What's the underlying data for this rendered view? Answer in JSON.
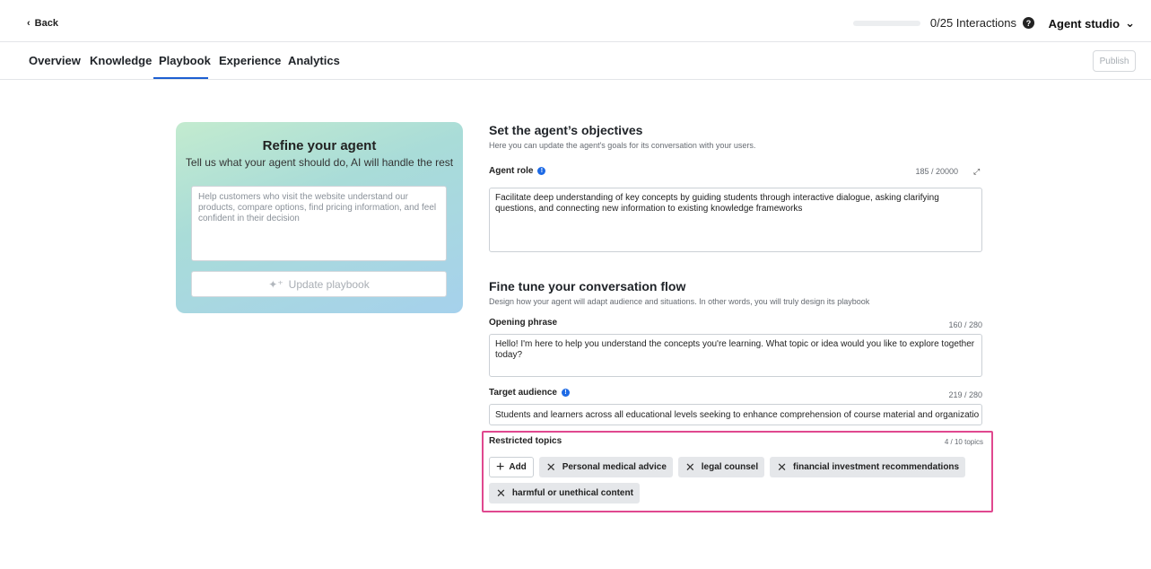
{
  "topbar": {
    "back_label": "Back",
    "interactions_label": "0/25 Interactions",
    "interactions_progress": 0,
    "studio_label": "Agent studio"
  },
  "tabs": [
    {
      "label": "Overview"
    },
    {
      "label": "Knowledge"
    },
    {
      "label": "Playbook",
      "active": true
    },
    {
      "label": "Experience"
    },
    {
      "label": "Analytics"
    }
  ],
  "publish_label": "Publish",
  "refine": {
    "title": "Refine your agent",
    "subtitle": "Tell us what your agent should do, AI will handle the rest",
    "placeholder": "Help customers who visit the website understand our products, compare options, find pricing information, and feel confident in their decision",
    "button_label": "Update playbook"
  },
  "objectives": {
    "title": "Set the agent’s objectives",
    "subtitle": "Here you can update the agent's goals for its conversation with your users.",
    "role_label": "Agent role",
    "role_counter": "185 / 20000",
    "role_value": "Facilitate deep understanding of key concepts by guiding students through interactive dialogue, asking clarifying questions, and connecting new information to existing knowledge frameworks"
  },
  "flow": {
    "title": "Fine tune your conversation flow",
    "subtitle": "Design how your agent will adapt audience and situations. In other words, you will truly design its playbook",
    "opening_label": "Opening phrase",
    "opening_counter": "160 / 280",
    "opening_value": "Hello! I'm here to help you understand the concepts you're learning. What topic or idea would you like to explore together today?",
    "audience_label": "Target audience",
    "audience_counter": "219 / 280",
    "audience_value": "Students and learners across all educational levels seeking to enhance comprehension of course material and organizatio"
  },
  "restricted": {
    "label": "Restricted topics",
    "counter": "4 / 10 topics",
    "add_label": "Add",
    "topics": [
      "Personal medical advice",
      "legal counsel",
      "financial investment recommendations",
      "harmful or unethical content"
    ]
  },
  "colors": {
    "accent": "#1d6ae5",
    "highlight_border": "#e0488f"
  }
}
